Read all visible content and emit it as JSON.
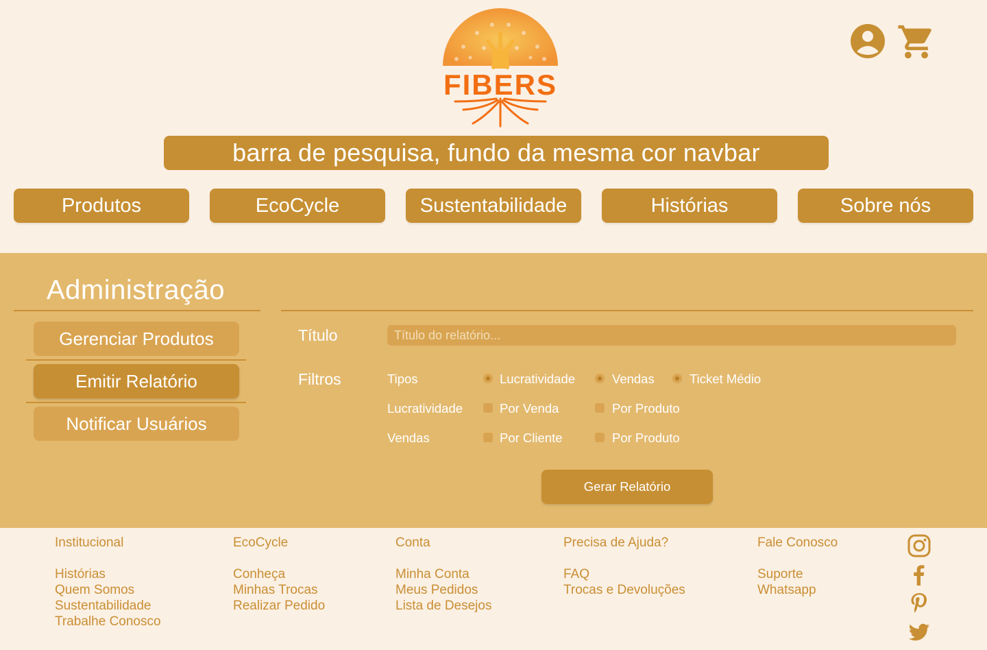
{
  "header": {
    "logo_text": "FIBERS",
    "search_text": "barra de pesquisa, fundo da mesma cor navbar",
    "icons": [
      "user-account-icon",
      "shopping-cart-icon"
    ]
  },
  "nav": {
    "items": [
      {
        "label": "Produtos"
      },
      {
        "label": "EcoCycle"
      },
      {
        "label": "Sustentabilidade"
      },
      {
        "label": "Histórias"
      },
      {
        "label": "Sobre nós"
      }
    ]
  },
  "admin": {
    "title": "Administração",
    "menu": [
      {
        "label": "Gerenciar Produtos",
        "active": false
      },
      {
        "label": "Emitir Relatório",
        "active": true
      },
      {
        "label": "Notificar Usuários",
        "active": false
      }
    ],
    "form": {
      "title_label": "Título",
      "title_placeholder": "Título do relatório...",
      "title_value": "",
      "filters_label": "Filtros",
      "rows": [
        {
          "label": "Tipos",
          "options": [
            {
              "label": "Lucratividade",
              "checked": true
            },
            {
              "label": "Vendas",
              "checked": true
            },
            {
              "label": "Ticket Médio",
              "checked": true
            }
          ]
        },
        {
          "label": "Lucratividade",
          "options": [
            {
              "label": "Por Venda",
              "checked": false
            },
            {
              "label": "Por Produto",
              "checked": false
            }
          ]
        },
        {
          "label": "Vendas",
          "options": [
            {
              "label": "Por Cliente",
              "checked": false
            },
            {
              "label": "Por Produto",
              "checked": false
            }
          ]
        }
      ],
      "submit_label": "Gerar Relatório"
    }
  },
  "footer": {
    "columns": [
      {
        "heading": "Institucional",
        "links": [
          "Histórias",
          "Quem Somos",
          "Sustentabilidade",
          "Trabalhe Conosco"
        ]
      },
      {
        "heading": "EcoCycle",
        "links": [
          "Conheça",
          "Minhas Trocas",
          "Realizar Pedido"
        ]
      },
      {
        "heading": "Conta",
        "links": [
          "Minha Conta",
          "Meus Pedidos",
          "Lista de Desejos"
        ]
      },
      {
        "heading": "Precisa de Ajuda?",
        "links": [
          "FAQ",
          "Trocas e Devoluções"
        ]
      },
      {
        "heading": "Fale Conosco",
        "links": [
          "Suporte",
          "Whatsapp"
        ]
      }
    ],
    "social": [
      "instagram-icon",
      "facebook-icon",
      "pinterest-icon",
      "twitter-icon"
    ]
  },
  "colors": {
    "background": "#FBF0E4",
    "primary": "#C78F33",
    "panel": "#E3B96E",
    "panel_control": "#D9A451",
    "footer_text": "#C98F34",
    "logo_orange": "#F26E12"
  }
}
